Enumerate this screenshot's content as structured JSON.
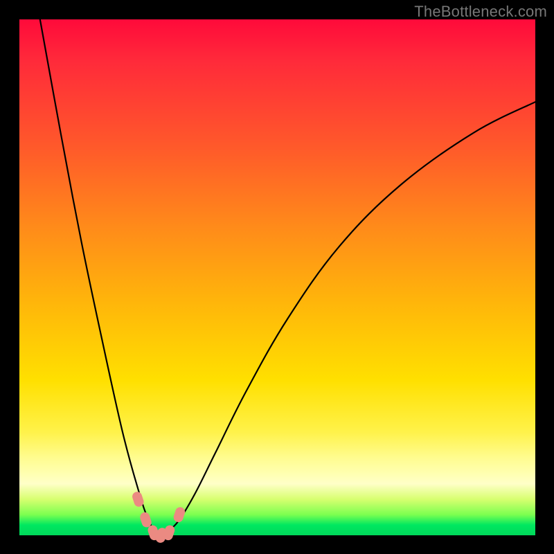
{
  "watermark": "TheBottleneck.com",
  "colors": {
    "frame": "#000000",
    "gradient_top": "#ff0a3a",
    "gradient_mid1": "#ff8a1a",
    "gradient_mid2": "#ffe000",
    "gradient_band": "#ffffb0",
    "gradient_bottom": "#00d85a",
    "curve": "#000000",
    "nubs": "#eb8a82"
  },
  "chart_data": {
    "type": "line",
    "title": "",
    "xlabel": "",
    "ylabel": "",
    "xlim": [
      0,
      100
    ],
    "ylim": [
      0,
      100
    ],
    "grid": false,
    "notes": "V-shaped bottleneck curve. x is a performance ratio axis (0–100), y is bottleneck percentage (0 = no bottleneck at bottom, 100 at top). Minimum (~0) occurs near x≈27. Left branch rises steeply; right branch rises with decreasing slope. Salmon-colored nubs mark points near the trough.",
    "x": [
      4,
      8,
      12,
      16,
      20,
      23,
      25,
      27,
      29,
      31,
      34,
      38,
      44,
      52,
      62,
      74,
      88,
      100
    ],
    "values": [
      100,
      78,
      57,
      38,
      20,
      9,
      3,
      0,
      1,
      3,
      8,
      16,
      28,
      42,
      56,
      68,
      78,
      84
    ],
    "trough_markers_x": [
      23,
      24.5,
      26,
      27.5,
      29,
      31
    ],
    "trough_markers_y": [
      7,
      3,
      0.5,
      0,
      0.5,
      4
    ]
  }
}
